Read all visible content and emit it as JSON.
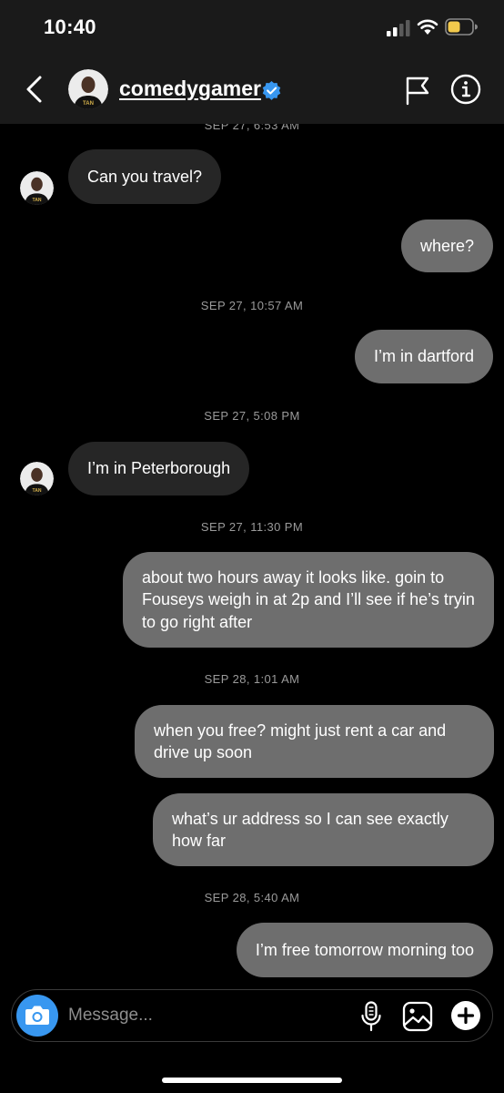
{
  "status_bar": {
    "time": "10:40"
  },
  "header": {
    "username": "comedygamer"
  },
  "messages": [
    {
      "kind": "timestamp",
      "text": "SEP 27, 6:53 AM"
    },
    {
      "kind": "received",
      "text": "Can you travel?"
    },
    {
      "kind": "sent",
      "text": "where?"
    },
    {
      "kind": "timestamp",
      "text": "SEP 27, 10:57 AM"
    },
    {
      "kind": "sent",
      "text": "I’m in dartford"
    },
    {
      "kind": "timestamp",
      "text": "SEP 27, 5:08 PM"
    },
    {
      "kind": "received",
      "text": "I’m in Peterborough"
    },
    {
      "kind": "timestamp",
      "text": "SEP 27, 11:30 PM"
    },
    {
      "kind": "sent",
      "text": "about two hours away it looks like. goin to Fouseys weigh in at 2p and I’ll see if he’s tryin to go right after"
    },
    {
      "kind": "timestamp",
      "text": "SEP 28, 1:01 AM"
    },
    {
      "kind": "sent",
      "text": "when you free? might just rent a car and drive up soon"
    },
    {
      "kind": "sent",
      "text": "what’s ur address so I can see exactly how far"
    },
    {
      "kind": "timestamp",
      "text": "SEP 28, 5:40 AM"
    },
    {
      "kind": "sent",
      "text": "I’m free tomorrow morning too"
    }
  ],
  "composer": {
    "placeholder": "Message..."
  },
  "colors": {
    "bar_bg": "#1a1a1a",
    "received_bubble": "#262626",
    "sent_bubble": "#6e6e6e",
    "accent_blue": "#3897f0",
    "battery_yellow": "#f2c94c",
    "timestamp_text": "#9a9a9a"
  },
  "icons": [
    "signal-icon",
    "wifi-icon",
    "battery-icon",
    "back-chevron-icon",
    "verified-badge-icon",
    "flag-icon",
    "info-icon",
    "camera-icon",
    "microphone-icon",
    "gallery-icon",
    "plus-icon"
  ]
}
